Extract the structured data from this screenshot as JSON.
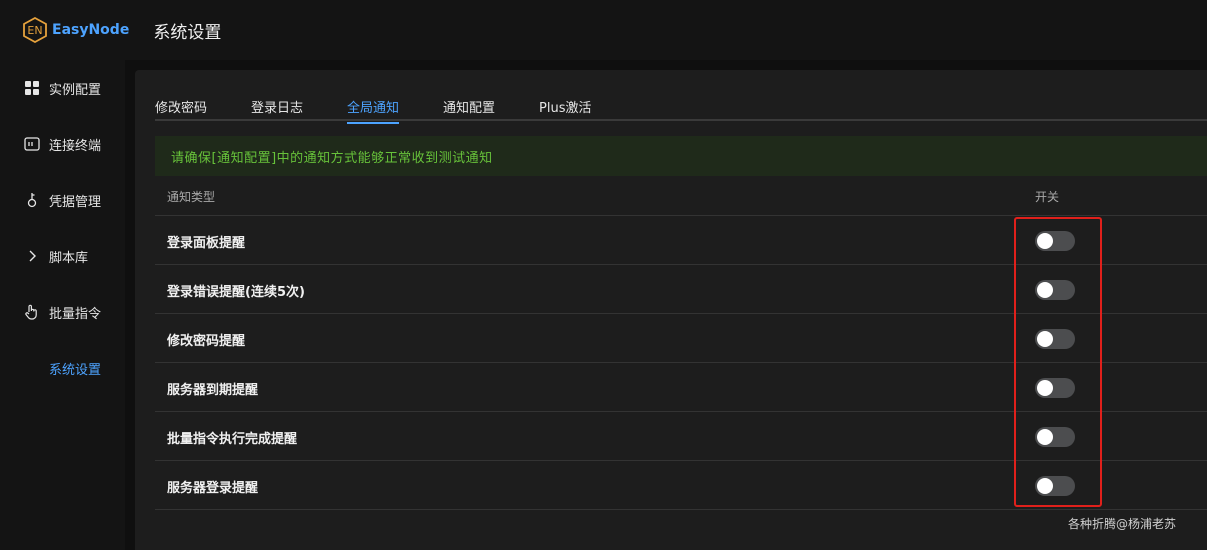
{
  "app": {
    "logo_text": "EasyNode",
    "logo_mark": "EN",
    "page_title": "系统设置"
  },
  "sidebar": {
    "items": [
      {
        "label": "实例配置",
        "icon": "grid-icon"
      },
      {
        "label": "连接终端",
        "icon": "terminal-icon"
      },
      {
        "label": "凭据管理",
        "icon": "key-icon"
      },
      {
        "label": "脚本库",
        "icon": "chevron-right-icon"
      },
      {
        "label": "批量指令",
        "icon": "pointer-hand-icon"
      },
      {
        "label": "系统设置",
        "active": true
      }
    ]
  },
  "tabs": [
    {
      "label": "修改密码"
    },
    {
      "label": "登录日志"
    },
    {
      "label": "全局通知",
      "active": true
    },
    {
      "label": "通知配置"
    },
    {
      "label": "Plus激活"
    }
  ],
  "alert": {
    "text": "请确保[通知配置]中的通知方式能够正常收到测试通知"
  },
  "table": {
    "headers": {
      "type": "通知类型",
      "switch": "开关"
    },
    "rows": [
      {
        "name": "登录面板提醒",
        "enabled": false
      },
      {
        "name": "登录错误提醒(连续5次)",
        "enabled": false
      },
      {
        "name": "修改密码提醒",
        "enabled": false
      },
      {
        "name": "服务器到期提醒",
        "enabled": false
      },
      {
        "name": "批量指令执行完成提醒",
        "enabled": false
      },
      {
        "name": "服务器登录提醒",
        "enabled": false
      }
    ]
  },
  "watermark": "各种折腾@杨浦老苏",
  "colors": {
    "accent": "#4da3ff",
    "alert_text": "#67c23a",
    "switch_off": "#4c4d4f",
    "highlight": "#e0201b"
  }
}
